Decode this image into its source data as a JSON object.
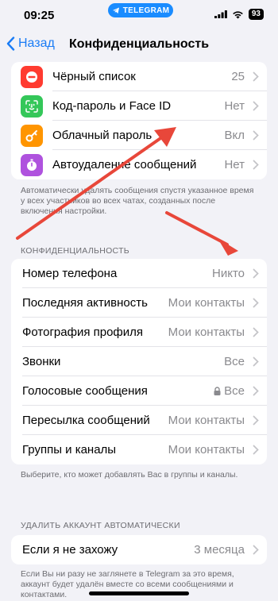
{
  "status_bar": {
    "time": "09:25",
    "app_pill": "TELEGRAM",
    "battery": "93"
  },
  "nav": {
    "back_label": "Назад",
    "title": "Конфиденциальность"
  },
  "top_group": {
    "items": [
      {
        "label": "Чёрный список",
        "value": "25",
        "icon": "block-icon",
        "color": "#ff3b30"
      },
      {
        "label": "Код-пароль и Face ID",
        "value": "Нет",
        "icon": "faceid-icon",
        "color": "#34c759"
      },
      {
        "label": "Облачный пароль",
        "value": "Вкл",
        "icon": "key-icon",
        "color": "#ff9500"
      },
      {
        "label": "Автоудаление сообщений",
        "value": "Нет",
        "icon": "timer-icon",
        "color": "#af52de"
      }
    ],
    "footnote": "Автоматически удалять сообщения спустя указанное время у всех участников во всех чатах, созданных после включения настройки."
  },
  "privacy_section": {
    "header": "КОНФИДЕНЦИАЛЬНОСТЬ",
    "items": [
      {
        "label": "Номер телефона",
        "value": "Никто"
      },
      {
        "label": "Последняя активность",
        "value": "Мои контакты"
      },
      {
        "label": "Фотография профиля",
        "value": "Мои контакты"
      },
      {
        "label": "Звонки",
        "value": "Все"
      },
      {
        "label": "Голосовые сообщения",
        "value": "Все",
        "locked": true
      },
      {
        "label": "Пересылка сообщений",
        "value": "Мои контакты"
      },
      {
        "label": "Группы и каналы",
        "value": "Мои контакты"
      }
    ],
    "footnote": "Выберите, кто может добавлять Вас в группы и каналы."
  },
  "delete_section": {
    "header": "УДАЛИТЬ АККАУНТ АВТОМАТИЧЕСКИ",
    "items": [
      {
        "label": "Если я не захожу",
        "value": "3 месяца"
      }
    ],
    "footnote": "Если Вы ни разу не заглянете в Telegram за это время, аккаунт будет удалён вместе со всеми сообщениями и контактами."
  },
  "colors": {
    "accent": "#1a7cf5",
    "annotation_arrow": "#e8473a"
  }
}
